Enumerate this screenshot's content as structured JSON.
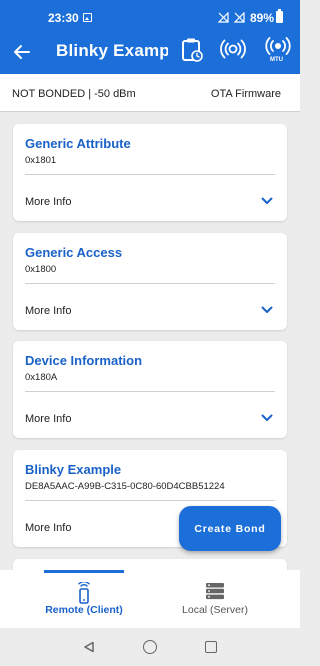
{
  "status_bar": {
    "time": "23:30",
    "battery": "89%"
  },
  "app_bar": {
    "title": "Blinky Example",
    "mtu_label": "MTU"
  },
  "info_row": {
    "connection_status": "NOT BONDED | -50 dBm",
    "ota_label": "OTA Firmware"
  },
  "services": [
    {
      "name": "Generic Attribute",
      "uuid": "0x1801",
      "more_info": "More Info"
    },
    {
      "name": "Generic Access",
      "uuid": "0x1800",
      "more_info": "More Info"
    },
    {
      "name": "Device Information",
      "uuid": "0x180A",
      "more_info": "More Info"
    },
    {
      "name": "Blinky Example",
      "uuid": "DE8A5AAC-A99B-C315-0C80-60D4CBB51224",
      "more_info": "More Info"
    }
  ],
  "fab": {
    "label": "Create Bond"
  },
  "bottom_nav": {
    "items": [
      {
        "label": "Remote (Client)",
        "selected": true
      },
      {
        "label": "Local (Server)",
        "selected": false
      }
    ]
  },
  "colors": {
    "primary": "#1c6fd9",
    "title_blue": "#1a62c8",
    "background": "#ececec"
  }
}
